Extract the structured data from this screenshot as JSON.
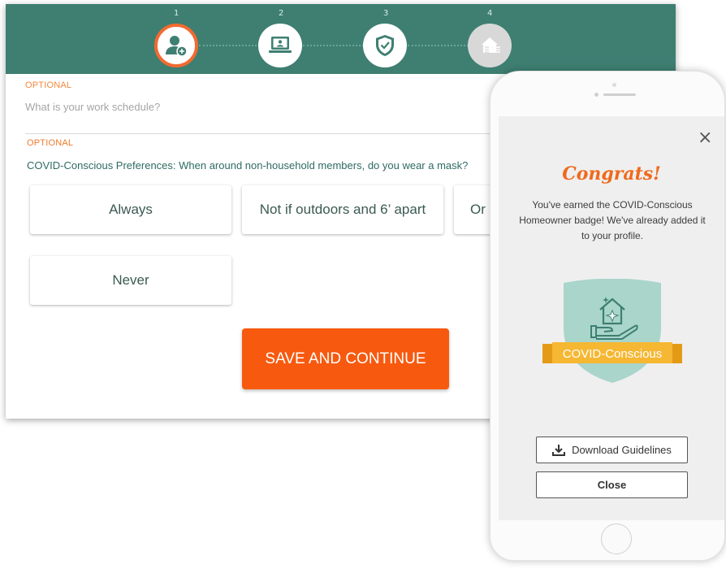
{
  "steps": [
    {
      "number": "1",
      "icon": "user-plus-icon",
      "state": "active"
    },
    {
      "number": "2",
      "icon": "laptop-user-icon",
      "state": "done"
    },
    {
      "number": "3",
      "icon": "shield-check-icon",
      "state": "done"
    },
    {
      "number": "4",
      "icon": "house-icon",
      "state": "future"
    }
  ],
  "form": {
    "q1_optional": "OPTIONAL",
    "q1_placeholder": "What is your work schedule?",
    "q2_optional": "OPTIONAL",
    "q2_question": "COVID-Conscious Preferences: When around non-household members, do you wear a mask?",
    "options": [
      "Always",
      "Not if outdoors and 6’ apart",
      "Or",
      "Never"
    ],
    "save_label": "SAVE AND CONTINUE"
  },
  "modal": {
    "close_icon": "×",
    "congrats": "Congrats!",
    "earned_text": "You've earned the COVID-Conscious Homeowner badge! We've already added it to your profile.",
    "badge_label": "COVID-Conscious",
    "download_label": "Download Guidelines",
    "close_label": "Close"
  },
  "colors": {
    "stepbar": "#3e7f72",
    "accent": "#f75a0f",
    "badge_teal": "#a9d5cb",
    "badge_ribbon": "#f6b733"
  }
}
